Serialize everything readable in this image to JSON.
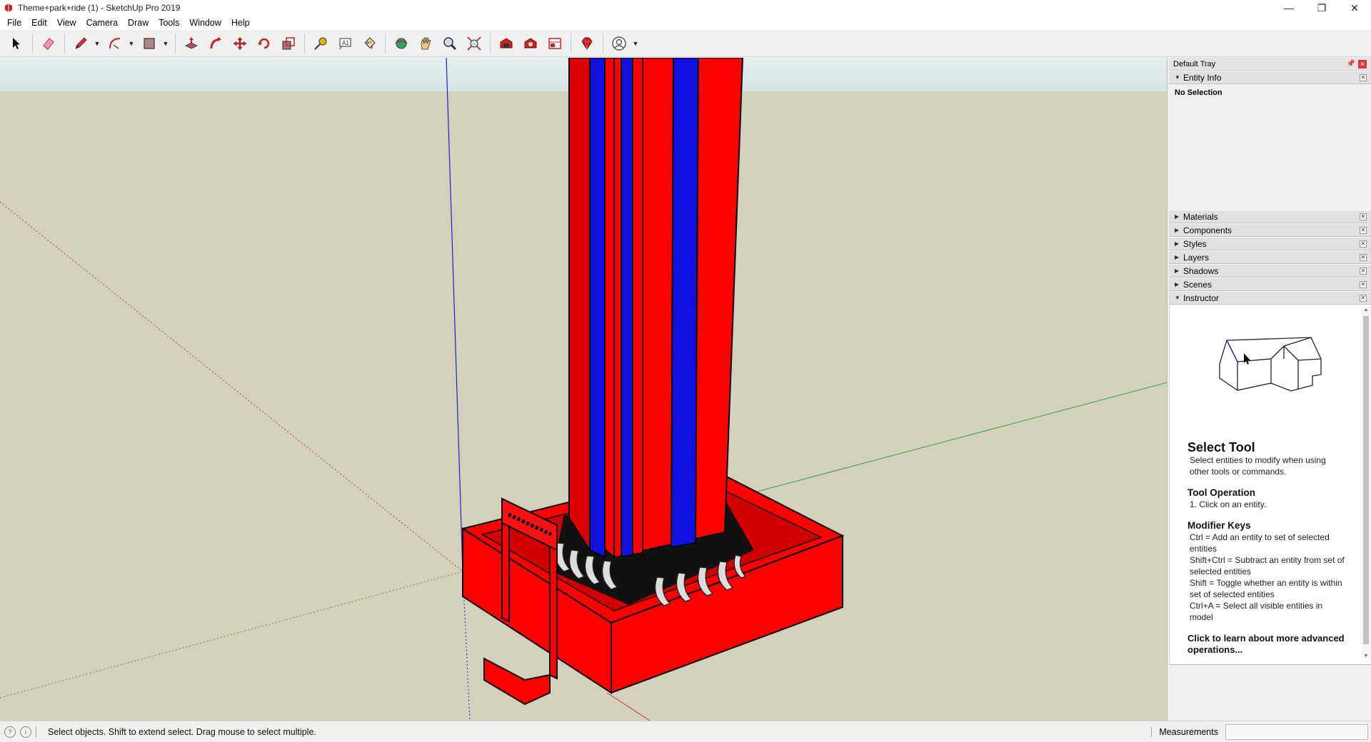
{
  "window": {
    "title": "Theme+park+ride (1) - SketchUp Pro 2019",
    "minimize": "—",
    "restore": "❐",
    "close": "✕"
  },
  "menu": [
    "File",
    "Edit",
    "View",
    "Camera",
    "Draw",
    "Tools",
    "Window",
    "Help"
  ],
  "toolbar": {
    "icons": [
      "select-icon",
      "eraser-icon",
      "pencil-icon",
      "arc-icon",
      "rectangle-icon",
      "push-pull-icon",
      "follow-me-icon",
      "move-icon",
      "rotate-icon",
      "scale-icon",
      "tape-measure-icon",
      "text-icon",
      "paint-bucket-icon",
      "orbit-icon",
      "pan-icon",
      "zoom-icon",
      "zoom-extents-icon",
      "warehouse-icon",
      "extension-warehouse-icon",
      "layout-icon",
      "ruby-icon",
      "account-icon"
    ]
  },
  "tray": {
    "title": "Default Tray",
    "entity_info": {
      "label": "Entity Info",
      "value": "No Selection"
    },
    "panels": [
      "Materials",
      "Components",
      "Styles",
      "Layers",
      "Shadows",
      "Scenes"
    ],
    "instructor": {
      "label": "Instructor",
      "heading": "Select Tool",
      "description": "Select entities to modify when using other tools or commands.",
      "op_heading": "Tool Operation",
      "op_text": "1. Click on an entity.",
      "mod_heading": "Modifier Keys",
      "mod_lines": [
        "Ctrl = Add an entity to set of selected entities",
        "Shift+Ctrl = Subtract an entity from set of selected entities",
        "Shift = Toggle whether an entity is within set of selected entities",
        "Ctrl+A = Select all visible entities in model"
      ],
      "more": "Click to learn about more advanced operations..."
    }
  },
  "status": {
    "text": "Select objects. Shift to extend select. Drag mouse to select multiple.",
    "measurements_label": "Measurements",
    "measurements_value": ""
  },
  "colors": {
    "ground": "#d3d0bb",
    "model_red": "#ff0000",
    "model_blue": "#1010e0",
    "blue_axis": "#2222cc",
    "green_axis": "#33aa33",
    "red_axis": "#c04040"
  }
}
